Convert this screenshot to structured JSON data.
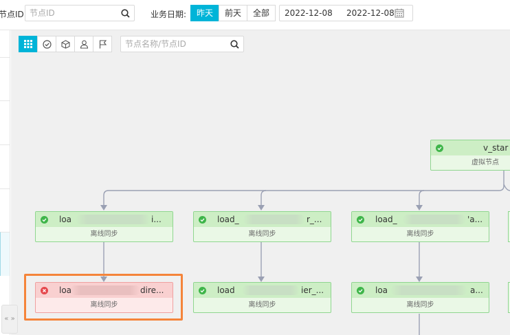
{
  "filters": {
    "node_id_label": "节点ID:",
    "node_id_placeholder": "节点ID",
    "biz_date_label": "业务日期:",
    "date_buttons": [
      "昨天",
      "前天",
      "全部"
    ],
    "active_date_button": "昨天",
    "start_date": "2022-12-08",
    "end_date": "2022-12-08"
  },
  "graph_toolbar": {
    "buttons": [
      "grid-icon",
      "check-circle-icon",
      "cube-icon",
      "user-icon",
      "flag-icon"
    ],
    "active": "grid-icon",
    "search_placeholder": "节点名称/节点ID"
  },
  "nodes": [
    {
      "name": "v_star",
      "type": "虚拟节点",
      "status": "success"
    },
    {
      "name": "loa",
      "name_tail": "i...",
      "type": "离线同步",
      "status": "success"
    },
    {
      "name": "load_",
      "name_tail": "r_...",
      "type": "离线同步",
      "status": "success"
    },
    {
      "name": "load_",
      "name_tail": "'a...",
      "type": "离线同步",
      "status": "success"
    },
    {
      "name": "loa",
      "name_tail": "dire...",
      "type": "离线同步",
      "status": "failed"
    },
    {
      "name": "load",
      "name_tail": "ier_...",
      "type": "离线同步",
      "status": "success"
    },
    {
      "name": "loa",
      "name_tail": "a...",
      "type": "离线同步",
      "status": "success"
    }
  ],
  "colors": {
    "accent": "#00b4d8",
    "success": "#3fb54a",
    "failed": "#e5484d",
    "highlight_box": "#f5843a"
  },
  "collapse_glyph": "« »"
}
